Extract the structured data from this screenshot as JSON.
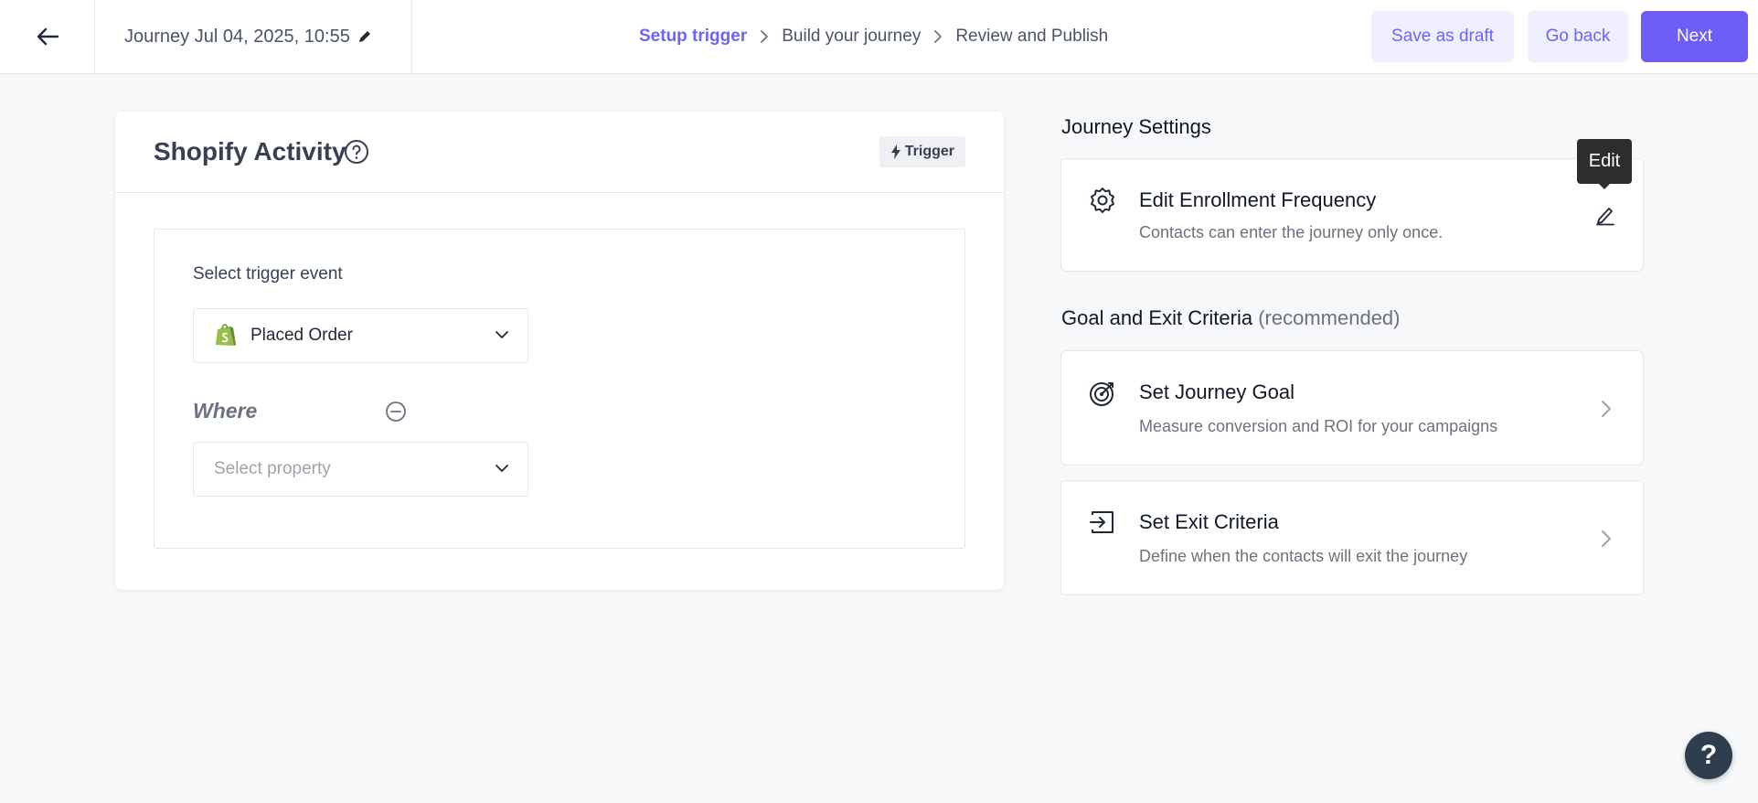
{
  "header": {
    "journey_title": "Journey Jul 04, 2025, 10:55",
    "steps": [
      "Setup trigger",
      "Build your journey",
      "Review and Publish"
    ],
    "active_step": "Setup trigger",
    "buttons": {
      "save_draft": "Save as draft",
      "go_back": "Go back",
      "next": "Next"
    }
  },
  "trigger_card": {
    "title": "Shopify Activity",
    "badge": "Trigger",
    "field_label": "Select trigger event",
    "selected_event": "Placed Order",
    "where_label": "Where",
    "property_placeholder": "Select property"
  },
  "journey_settings": {
    "title": "Journey Settings",
    "enrollment": {
      "title": "Edit Enrollment Frequency",
      "description": "Contacts can enter the journey only once.",
      "tooltip": "Edit"
    }
  },
  "goal_exit": {
    "title": "Goal and Exit Criteria",
    "subtitle": "(recommended)",
    "goal": {
      "title": "Set Journey Goal",
      "description": "Measure conversion and ROI for your campaigns"
    },
    "exit": {
      "title": "Set Exit Criteria",
      "description": "Define when the contacts will exit the journey"
    }
  },
  "help_fab": "?",
  "colors": {
    "accent": "#6c63ff",
    "primary_button": "#6e5ef5",
    "light_button": "#f0efff",
    "shopify_green": "#95bf47"
  },
  "icons": [
    "arrow-left-icon",
    "pencil-icon",
    "chevron-right-icon",
    "help-circle-icon",
    "lightning-icon",
    "shopify-icon",
    "chevron-down-icon",
    "minus-circle-icon",
    "gear-icon",
    "target-icon",
    "exit-icon"
  ]
}
